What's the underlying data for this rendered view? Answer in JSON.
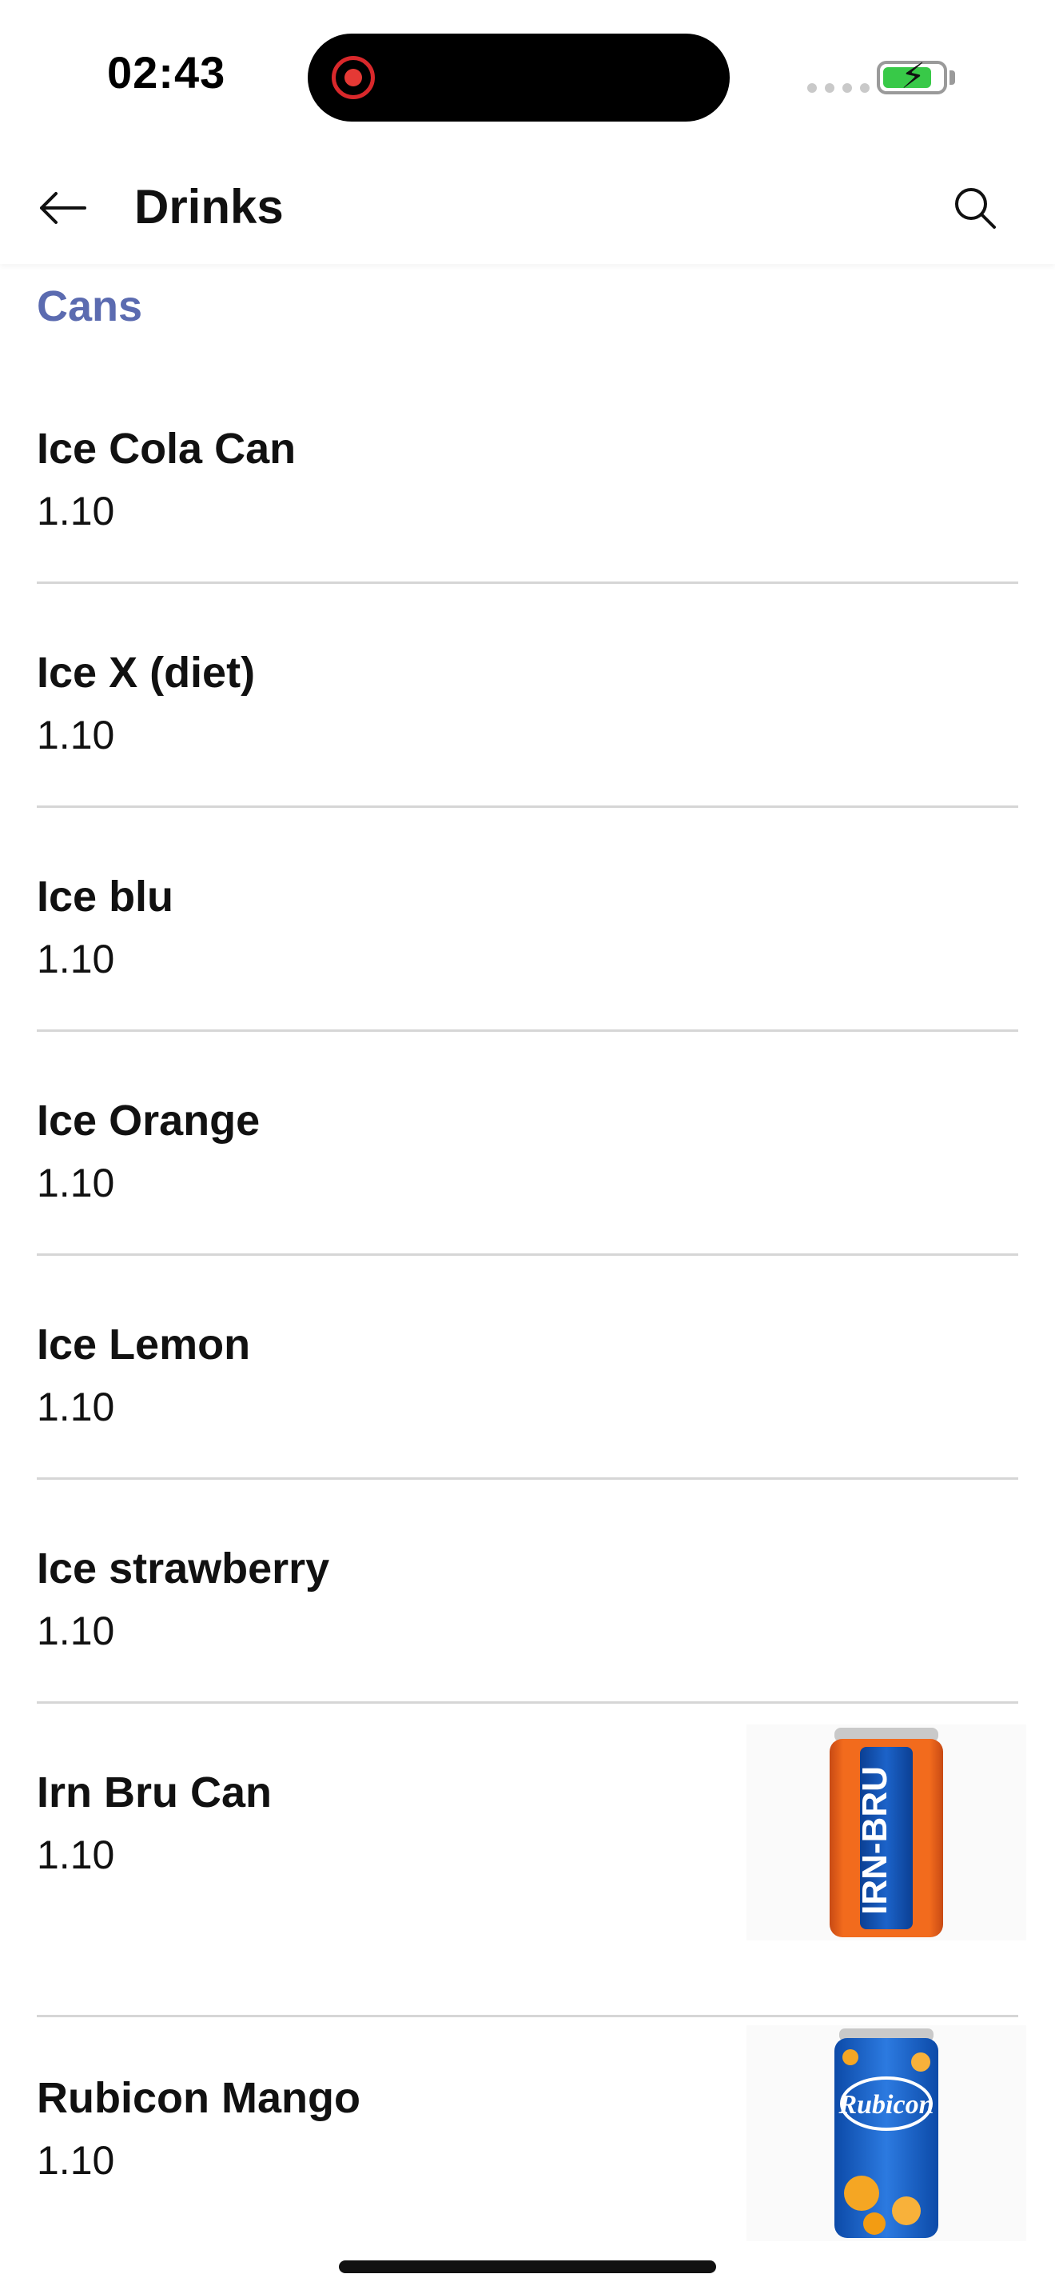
{
  "status_bar": {
    "time": "02:43",
    "recording_icon": "screen-record-icon",
    "signal_icon": "cellular-signal-icon",
    "battery_icon": "battery-charging-icon"
  },
  "header": {
    "back_icon": "arrow-left-icon",
    "title": "Drinks",
    "search_icon": "search-icon"
  },
  "section": {
    "title": "Cans",
    "accent_color": "#5b6bb0"
  },
  "items": [
    {
      "name": "Ice Cola Can",
      "price": "1.10",
      "image": null
    },
    {
      "name": "Ice X (diet)",
      "price": "1.10",
      "image": null
    },
    {
      "name": "Ice blu",
      "price": "1.10",
      "image": null
    },
    {
      "name": "Ice Orange",
      "price": "1.10",
      "image": null
    },
    {
      "name": "Ice Lemon",
      "price": "1.10",
      "image": null
    },
    {
      "name": "Ice strawberry",
      "price": "1.10",
      "image": null
    },
    {
      "name": "Irn Bru Can",
      "price": "1.10",
      "image": "irn-bru-can-photo",
      "image_text": "IRN-BRU"
    },
    {
      "name": "Rubicon Mango",
      "price": "1.10",
      "image": "rubicon-mango-can-photo",
      "image_text": "Rubicon"
    }
  ]
}
